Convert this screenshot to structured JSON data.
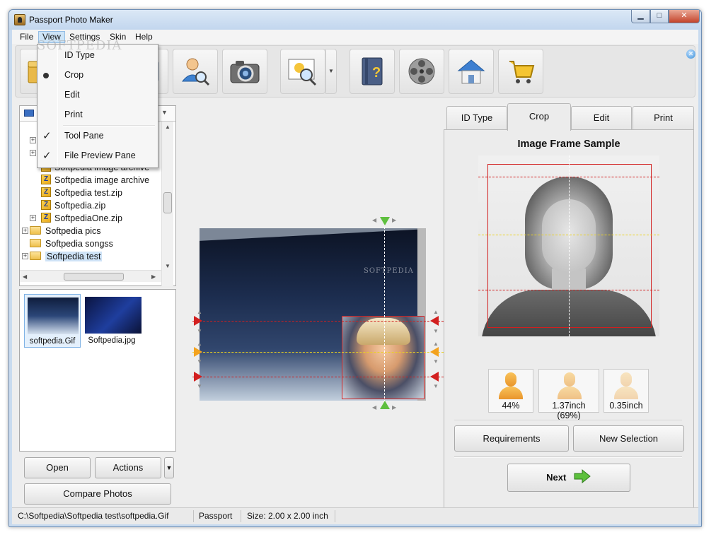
{
  "window": {
    "title": "Passport Photo Maker",
    "minimize": "▁",
    "maximize": "□",
    "close": "✕"
  },
  "menubar": {
    "items": [
      "File",
      "View",
      "Settings",
      "Skin",
      "Help"
    ]
  },
  "view_menu": {
    "items": [
      {
        "label": "ID Type",
        "mark": ""
      },
      {
        "label": "Crop",
        "mark": "radio"
      },
      {
        "label": "Edit",
        "mark": ""
      },
      {
        "label": "Print",
        "mark": ""
      },
      {
        "label": "Tool Pane",
        "mark": "check"
      },
      {
        "label": "File Preview Pane",
        "mark": "check"
      }
    ],
    "check_glyph": "✓"
  },
  "watermark": "SOFTPEDIA",
  "toolbar": {
    "icons": [
      "open-folder-icon",
      "id-type-icon",
      "user-search-icon",
      "camera-icon",
      "image-zoom-icon",
      "help-book-icon",
      "video-tutorial-icon",
      "home-icon",
      "shopping-cart-icon"
    ],
    "dropdown_arrow": "▼",
    "close_glyph": "✕"
  },
  "file_tree": {
    "combo_arrow": "▼",
    "rows": [
      {
        "label": "Softpedia image archive",
        "type": "zip"
      },
      {
        "label": "Softpedia image archive",
        "type": "zip"
      },
      {
        "label": "Softpedia test.zip",
        "type": "zip"
      },
      {
        "label": "Softpedia.zip",
        "type": "zip"
      },
      {
        "label": "SoftpediaOne.zip",
        "type": "zip"
      },
      {
        "label": "Softpedia pics",
        "type": "folder"
      },
      {
        "label": "Softpedia songss",
        "type": "folder"
      },
      {
        "label": "Softpedia test",
        "type": "folder"
      }
    ]
  },
  "preview": {
    "files": [
      "softpedia.Gif",
      "Softpedia.jpg"
    ]
  },
  "left_buttons": {
    "open": "Open",
    "actions": "Actions",
    "more": "▼",
    "compare": "Compare Photos"
  },
  "tabs": [
    "ID Type",
    "Crop",
    "Edit",
    "Print"
  ],
  "active_tab": "Crop",
  "crop_panel": {
    "title": "Image Frame Sample",
    "metrics": [
      "44%",
      "1.37inch (69%)",
      "0.35inch"
    ],
    "requirements_button": "Requirements",
    "new_selection_button": "New Selection",
    "next_button": "Next"
  },
  "statusbar": {
    "path": "C:\\Softpedia\\Softpedia test\\softpedia.Gif",
    "type": "Passport",
    "size": "Size: 2.00 x 2.00 inch"
  },
  "colors": {
    "guide_red": "#d21f1f",
    "guide_yellow": "#ecd21f",
    "handle_green": "#5fbf3f",
    "handle_orange": "#f3a21f"
  }
}
